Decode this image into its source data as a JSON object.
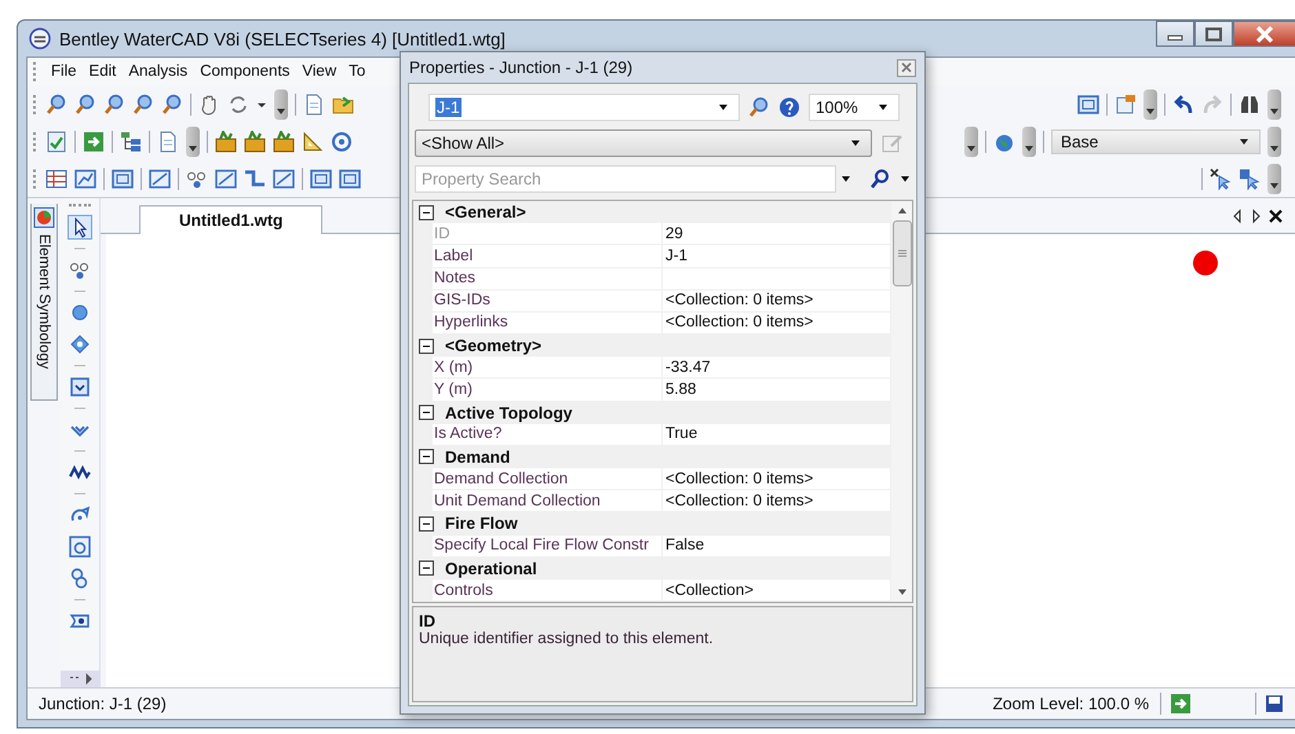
{
  "window": {
    "title": "Bentley WaterCAD V8i (SELECTseries 4) [Untitled1.wtg]"
  },
  "menu": [
    "File",
    "Edit",
    "Analysis",
    "Components",
    "View",
    "To"
  ],
  "toolbar": {
    "scenario": "Base"
  },
  "side_tab": "Element Symbology",
  "document_tabs": [
    {
      "label": "Untitled1.wtg",
      "selected": true
    }
  ],
  "status_bar": {
    "element": "Junction: J-1 (29)",
    "zoom": "Zoom Level: 100.0 %"
  },
  "properties": {
    "title": "Properties - Junction - J-1 (29)",
    "element": "J-1",
    "zoom": "100%",
    "filter": "<Show All>",
    "search": {
      "placeholder": "Property Search"
    },
    "categories": [
      {
        "name": "<General>",
        "expanded": true,
        "rows": [
          {
            "name": "ID",
            "value": "29",
            "disabled": true
          },
          {
            "name": "Label",
            "value": "J-1",
            "disabled": false
          },
          {
            "name": "Notes",
            "value": "",
            "disabled": false
          },
          {
            "name": "GIS-IDs",
            "value": "<Collection: 0 items>",
            "disabled": false
          },
          {
            "name": "Hyperlinks",
            "value": "<Collection: 0 items>",
            "disabled": false
          }
        ]
      },
      {
        "name": "<Geometry>",
        "expanded": true,
        "rows": [
          {
            "name": "X (m)",
            "value": "-33.47",
            "disabled": false
          },
          {
            "name": "Y (m)",
            "value": "5.88",
            "disabled": false
          }
        ]
      },
      {
        "name": "Active Topology",
        "expanded": true,
        "rows": [
          {
            "name": "Is Active?",
            "value": "True",
            "disabled": false
          }
        ]
      },
      {
        "name": "Demand",
        "expanded": true,
        "rows": [
          {
            "name": "Demand Collection",
            "value": "<Collection: 0 items>",
            "disabled": false
          },
          {
            "name": "Unit Demand Collection",
            "value": "<Collection: 0 items>",
            "disabled": false
          }
        ]
      },
      {
        "name": "Fire Flow",
        "expanded": true,
        "rows": [
          {
            "name": "Specify Local Fire Flow Constr",
            "value": "False",
            "disabled": false
          }
        ]
      },
      {
        "name": "Operational",
        "expanded": true,
        "rows": [
          {
            "name": "Controls",
            "value": "<Collection>",
            "disabled": false
          }
        ]
      }
    ],
    "description": {
      "title": "ID",
      "text": "Unique identifier assigned to this element."
    }
  }
}
